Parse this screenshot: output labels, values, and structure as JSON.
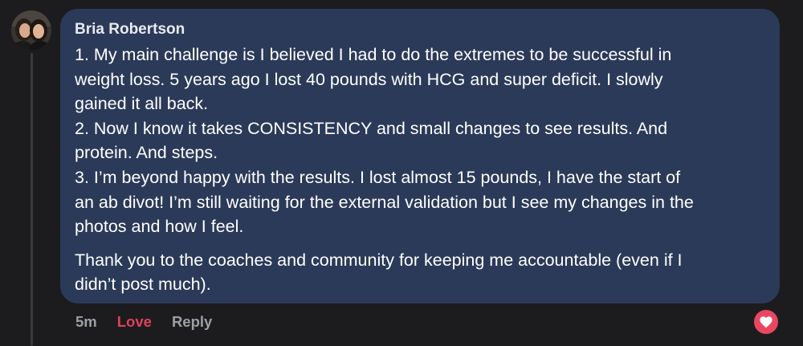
{
  "comment": {
    "author": "Bria Robertson",
    "paragraphs": [
      {
        "lines": [
          "1. My main challenge is I believed I had to do the extremes to be successful in",
          "weight loss. 5 years ago I lost 40 pounds with HCG and super deficit. I slowly",
          "gained it all back.",
          "2. Now I know it takes CONSISTENCY and small changes to see results. And",
          "protein. And steps.",
          "3. I’m beyond happy with the results. I lost almost 15 pounds, I have the start of",
          "an ab divot! I’m still waiting for the external validation but I see my changes in the",
          "photos and how I feel."
        ]
      },
      {
        "lines": [
          "Thank you to the coaches and community for keeping me accountable (even if I",
          "didn’t post much)."
        ]
      }
    ],
    "colors": {
      "bubble": "#2b3a58",
      "love": "#e0405a",
      "reaction": "#e8475f"
    }
  },
  "actions": {
    "timestamp": "5m",
    "love_label": "Love",
    "reply_label": "Reply"
  },
  "reaction": {
    "icon": "heart-icon"
  },
  "avatar": {
    "icon": "profile-photo"
  }
}
